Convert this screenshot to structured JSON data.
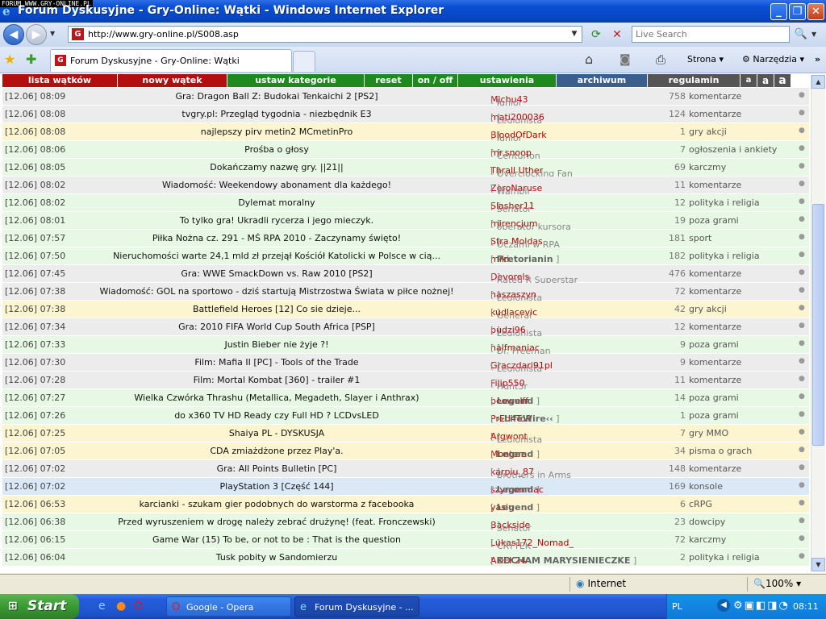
{
  "window": {
    "title": "Forum Dyskusyjne - Gry-Online: Wątki - Windows Internet Explorer",
    "watermark": "FORUM WWW.GRY-ONLINE.PL",
    "min": "_",
    "max": "❐",
    "close": "✕"
  },
  "nav": {
    "url": "http://www.gry-online.pl/S008.asp",
    "search_placeholder": "Live Search"
  },
  "tab": {
    "label": "Forum Dyskusyjne - Gry-Online: Wątki"
  },
  "commands": {
    "page": "Strona",
    "tools": "Narzędzia",
    "more": "»"
  },
  "menu": [
    {
      "label": "lista wątków",
      "color": "#b30f0f"
    },
    {
      "label": "nowy wątek",
      "color": "#b30f0f"
    },
    {
      "label": "ustaw kategorie",
      "color": "#1e8a1e"
    },
    {
      "label": "reset",
      "color": "#1e8a1e"
    },
    {
      "label": "on / off",
      "color": "#1e8a1e"
    },
    {
      "label": "ustawienia",
      "color": "#1e8a1e"
    },
    {
      "label": "archiwum",
      "color": "#3b5e8c"
    },
    {
      "label": "regulamin",
      "color": "#555555"
    },
    {
      "label": "a",
      "color": "#555555"
    },
    {
      "label": "a",
      "color": "#555555"
    },
    {
      "label": "a",
      "color": "#555555"
    }
  ],
  "threads": [
    {
      "time": "[12.06] 08:09",
      "title": "Gra: Dragon Ball Z: Budokai Tenkaichi 2 [PS2]",
      "user": "Michu43",
      "rank": "Junior",
      "rank_bold": false,
      "count": "758",
      "category": "komentarze",
      "bg": "grey"
    },
    {
      "time": "[12.06] 08:08",
      "title": "tvgry.pl: Przegląd tygodnia - niezbędnik E3",
      "user": "mati200036",
      "rank": "Legionista",
      "rank_bold": false,
      "count": "124",
      "category": "komentarze",
      "bg": "grey"
    },
    {
      "time": "[12.06] 08:08",
      "title": "najlepszy pirv metin2 MCmetinPro",
      "user": "BloodOfDark",
      "rank": "Junior",
      "rank_bold": false,
      "count": "1",
      "category": "gry akcji",
      "bg": "yellow"
    },
    {
      "time": "[12.06] 08:06",
      "title": "Prośba o głosy",
      "user": "mr.snoop",
      "rank": "Centurion",
      "rank_bold": false,
      "count": "7",
      "category": "ogłoszenia i ankiety",
      "bg": "green"
    },
    {
      "time": "[12.06] 08:05",
      "title": "Dokańczamy nazwę gry. ||21||",
      "user": "Thrall Uther",
      "rank": "Overclocking Fan",
      "rank_bold": false,
      "count": "69",
      "category": "karczmy",
      "bg": "green"
    },
    {
      "time": "[12.06] 08:02",
      "title": "Wiadomość: Weekendowy abonament dla każdego!",
      "user": "ZeroNaruse",
      "rank": "Wampir",
      "rank_bold": false,
      "count": "11",
      "category": "komentarze",
      "bg": "grey"
    },
    {
      "time": "[12.06] 08:02",
      "title": "Dylemat moralny",
      "user": "Slasher11",
      "rank": "Senator",
      "rank_bold": false,
      "count": "12",
      "category": "polityka i religia",
      "bg": "green"
    },
    {
      "time": "[12.06] 08:01",
      "title": "To tylko gra! Ukradli rycerza i jego mieczyk.",
      "user": "mirencjum",
      "rank": "operator kursora",
      "rank_bold": false,
      "count": "19",
      "category": "poza grami",
      "bg": "green"
    },
    {
      "time": "[12.06] 07:57",
      "title": "Piłka Nożna cz. 291 - MŚ RPA 2010 - Zaczynamy święto!",
      "user": "Stra Moldas",
      "rank": "Oczami w RPA",
      "rank_bold": false,
      "count": "181",
      "category": "sport",
      "bg": "green"
    },
    {
      "time": "[12.06] 07:50",
      "title": "Nieruchomości warte 24,1 mld zł przejął Kościół Katolicki w Polsce w cią...",
      "user": "miki",
      "rank": "Pretorianin",
      "rank_bold": true,
      "count": "182",
      "category": "polityka i religia",
      "bg": "green"
    },
    {
      "time": "[12.06] 07:45",
      "title": "Gra: WWE SmackDown vs. Raw 2010 [PS2]",
      "user": "Devorels",
      "rank": "Rated R Superstar",
      "rank_bold": false,
      "count": "476",
      "category": "komentarze",
      "bg": "grey"
    },
    {
      "time": "[12.06] 07:38",
      "title": "Wiadomość: GOL na sportowo - dziś startują Mistrzostwa Świata w piłce nożnej!",
      "user": "haszaszyn",
      "rank": "Legionista",
      "rank_bold": false,
      "count": "72",
      "category": "komentarze",
      "bg": "grey"
    },
    {
      "time": "[12.06] 07:38",
      "title": "Battlefield Heroes [12] Co sie dzieje...",
      "user": "kudlacevic",
      "rank": "Generał",
      "rank_bold": false,
      "count": "42",
      "category": "gry akcji",
      "bg": "yellow"
    },
    {
      "time": "[12.06] 07:34",
      "title": "Gra: 2010 FIFA World Cup South Africa [PSP]",
      "user": "pudzi96",
      "rank": "Legionista",
      "rank_bold": false,
      "count": "12",
      "category": "komentarze",
      "bg": "grey"
    },
    {
      "time": "[12.06] 07:33",
      "title": "Justin Bieber nie żyje ?!",
      "user": "halfmaniac",
      "rank": "Dr. Freeman",
      "rank_bold": false,
      "count": "9",
      "category": "poza grami",
      "bg": "green"
    },
    {
      "time": "[12.06] 07:30",
      "title": "Film: Mafia II [PC] - Tools of the Trade",
      "user": "Graczdari91pl",
      "rank": "Legionista",
      "rank_bold": false,
      "count": "9",
      "category": "komentarze",
      "bg": "grey"
    },
    {
      "time": "[12.06] 07:28",
      "title": "Film: Mortal Kombat [360] - trailer #1",
      "user": "Filip550",
      "rank": "Hunt3r",
      "rank_bold": false,
      "count": "11",
      "category": "komentarze",
      "bg": "grey"
    },
    {
      "time": "[12.06] 07:27",
      "title": "Wielka Czwórka Thrashu (Metallica, Megadeth, Slayer i Anthrax)",
      "user": "beowulff",
      "rank": "Legend",
      "rank_bold": true,
      "count": "14",
      "category": "poza grami",
      "bg": "green"
    },
    {
      "time": "[12.06] 07:26",
      "title": "do x360 TV HD Ready czy Full HD ? LCDvsLED",
      "user": "PrEd4ToR",
      "rank": "››LifeWire‹‹",
      "rank_bold": true,
      "count": "1",
      "category": "poza grami",
      "bg": "green"
    },
    {
      "time": "[12.06] 07:25",
      "title": "Shaiya PL - DYSKUSJA",
      "user": "Argwont",
      "rank": "Legionista",
      "rank_bold": false,
      "count": "7",
      "category": "gry MMO",
      "bg": "yellow"
    },
    {
      "time": "[12.06] 07:05",
      "title": "CDA zmiażdżone przez Play'a.",
      "user": "Montera",
      "rank": "Legend",
      "rank_bold": true,
      "count": "34",
      "category": "pisma o grach",
      "bg": "yellow"
    },
    {
      "time": "[12.06] 07:02",
      "title": "Gra: All Points Bulletin [PC]",
      "user": "karpiu_87",
      "rank": "Brothers in Arms",
      "rank_bold": false,
      "count": "148",
      "category": "komentarze",
      "bg": "grey"
    },
    {
      "time": "[12.06] 07:02",
      "title": "PlayStation 3 [Część 144]",
      "user": "szymonmac",
      "rank": "Legend",
      "rank_bold": true,
      "count": "169",
      "category": "konsole",
      "bg": "blue"
    },
    {
      "time": "[12.06] 06:53",
      "title": "karcianki - szukam gier podobnych do warstorma z facebooka",
      "user": "yasiu",
      "rank": "Legend",
      "rank_bold": true,
      "count": "6",
      "category": "cRPG",
      "bg": "yellow"
    },
    {
      "time": "[12.06] 06:38",
      "title": "Przed wyruszeniem w drogę należy zebrać drużynę! (feat. Fronczewski)",
      "user": "Backside",
      "rank": "Senator",
      "rank_bold": false,
      "count": "23",
      "category": "dowcipy",
      "bg": "green"
    },
    {
      "time": "[12.06] 06:15",
      "title": "Game War (15) To be, or not to be : That is the question",
      "user": "Lukas172_Nomad_",
      "rank": "CRYTEK",
      "rank_bold": false,
      "count": "72",
      "category": "karczmy",
      "bg": "green"
    },
    {
      "time": "[12.06] 06:04",
      "title": "Tusk pobity w Sandomierzu",
      "user": "ADEK24",
      "rank": "KOCHAM MARYSIENIECZKE",
      "rank_bold": true,
      "count": "2",
      "category": "polityka i religia",
      "bg": "green"
    }
  ],
  "status": {
    "zone": "Internet",
    "zoom": "100%"
  },
  "taskbar": {
    "start": "Start",
    "items": [
      {
        "label": "Google - Opera",
        "active": false
      },
      {
        "label": "Forum Dyskusyjne - ...",
        "active": true
      }
    ],
    "lang": "PL",
    "clock": "08:11"
  }
}
